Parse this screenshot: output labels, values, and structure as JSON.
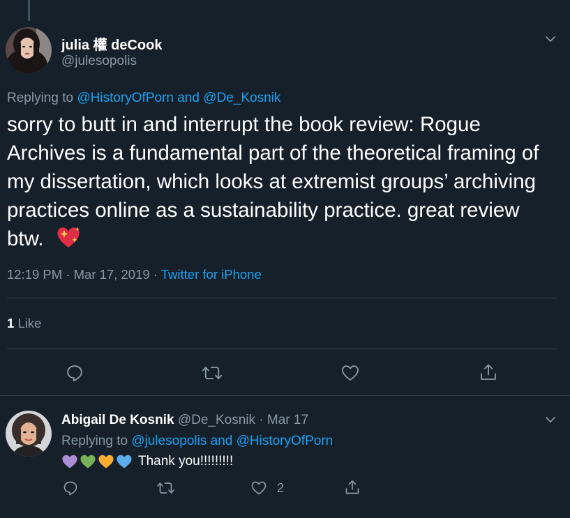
{
  "main_tweet": {
    "author_name": "julia 權 deCook",
    "author_handle": "@julesopolis",
    "replying_prefix": "Replying to",
    "replying_user1": "@HistoryOfPorn",
    "replying_and": "and",
    "replying_user2": "@De_Kosnik",
    "text": "sorry to butt in and interrupt the book review: Rogue Archives is a fundamental part of the theoretical framing of my dissertation, which looks at extremist groups’ archiving practices online as a sustainability practice. great review btw.",
    "time": "12:19 PM",
    "date": "Mar 17, 2019",
    "separator": "·",
    "source": "Twitter for iPhone",
    "like_count": "1",
    "like_label": "Like"
  },
  "reply_tweet": {
    "author_name": "Abigail De Kosnik",
    "author_handle": "@De_Kosnik",
    "separator": "·",
    "date": "Mar 17",
    "replying_prefix": "Replying to",
    "replying_user1": "@julesopolis",
    "replying_and": "and",
    "replying_user2": "@HistoryOfPorn",
    "text": "Thank you!!!!!!!!!",
    "like_count": "2",
    "heart_colors": [
      "#aa8ed6",
      "#78b159",
      "#ffac33",
      "#5dadec"
    ]
  },
  "colors": {
    "background": "#15202b",
    "link": "#1da1f2",
    "muted": "#8899a6",
    "border": "#38444d"
  },
  "icons": [
    "reply-icon",
    "retweet-icon",
    "like-icon",
    "share-icon",
    "chevron-down-icon",
    "sparkling-heart-icon"
  ]
}
